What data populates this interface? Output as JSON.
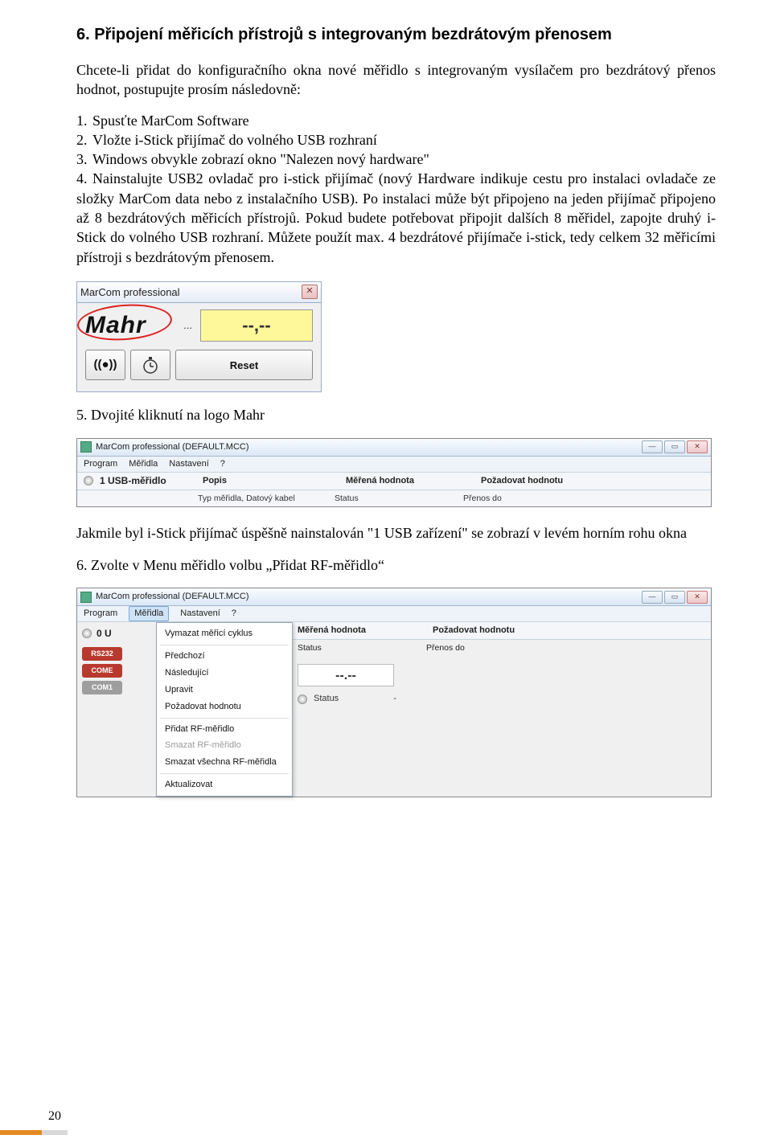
{
  "heading": "6. Připojení měřicích přístrojů s integrovaným bezdrátovým přenosem",
  "intro": "Chcete-li přidat do konfiguračního okna nové měřidlo s integrovaným vysílačem pro bezdrátový přenos hodnot, postupujte prosím následovně:",
  "steps": {
    "s1": "Spusťte MarCom Software",
    "s2": "Vložte i-Stick přijímač do volného USB rozhraní",
    "s3": "Windows obvykle zobrazí okno \"Nalezen nový hardware\"",
    "s4": "Nainstalujte USB2 ovladač pro i-stick přijímač (nový Hardware indikuje cestu pro instalaci ovladače ze složky MarCom data nebo z instalačního USB). Po instalaci může být připojeno na jeden přijímač připojeno až 8 bezdrátových měřicích přístrojů. Pokud budete potřebovat připojit dalších 8 měřidel, zapojte druhý i-Stick do volného USB rozhraní. Můžete použít max. 4 bezdrátové přijímače i-stick, tedy celkem 32 měřicími přístroji s bezdrátovým přenosem."
  },
  "shot1": {
    "title": "MarCom professional",
    "logo": "Mahr",
    "dots": "...",
    "display": "--,--",
    "wave": "((●))",
    "reset": "Reset"
  },
  "step5": "5. Dvojité kliknutí na logo Mahr",
  "shot2": {
    "title": "MarCom professional  (DEFAULT.MCC)",
    "menu": {
      "program": "Program",
      "meridla": "Měřidla",
      "nastaveni": "Nastavení",
      "q": "?"
    },
    "device": "1 USB-měřidlo",
    "cols": {
      "popis": "Popis",
      "mer": "Měřená hodnota",
      "poz": "Požadovat hodnotu"
    },
    "subcols": {
      "typ": "Typ měřidla, Datový kabel",
      "status": "Status",
      "prenos": "Přenos do"
    },
    "winbtn": {
      "min": "—",
      "max": "▭",
      "close": "✕"
    }
  },
  "para2": "Jakmile byl i-Stick přijímač úspěšně nainstalován \"1 USB zařízení\" se zobrazí v levém horním rohu okna",
  "step6": "6. Zvolte v Menu měřidlo volbu „Přidat RF-měřidlo“",
  "shot3": {
    "title": "MarCom professional  (DEFAULT.MCC)",
    "menu": {
      "program": "Program",
      "meridla": "Měřidla",
      "nastaveni": "Nastavení",
      "q": "?"
    },
    "devcount": "0 U",
    "badges": {
      "rs232": "RS232",
      "come": "COME",
      "com1": "COM1"
    },
    "dropdown": {
      "vymazat": "Vymazat měřicí cyklus",
      "predchozi": "Předchozí",
      "nasledujici": "Následující",
      "upravit": "Upravit",
      "pozadovat": "Požadovat hodnotu",
      "pridat": "Přidat RF-měřidlo",
      "smazat": "Smazat RF-měřidlo",
      "smazatvse": "Smazat všechna RF-měřidla",
      "aktualizovat": "Aktualizovat"
    },
    "cols": {
      "mer": "Měřená hodnota",
      "poz": "Požadovat hodnotu"
    },
    "subcols": {
      "status": "Status",
      "prenos": "Přenos do"
    },
    "display": "--.--",
    "statusword": "Status",
    "statusdash": "-"
  },
  "pagenum": "20"
}
